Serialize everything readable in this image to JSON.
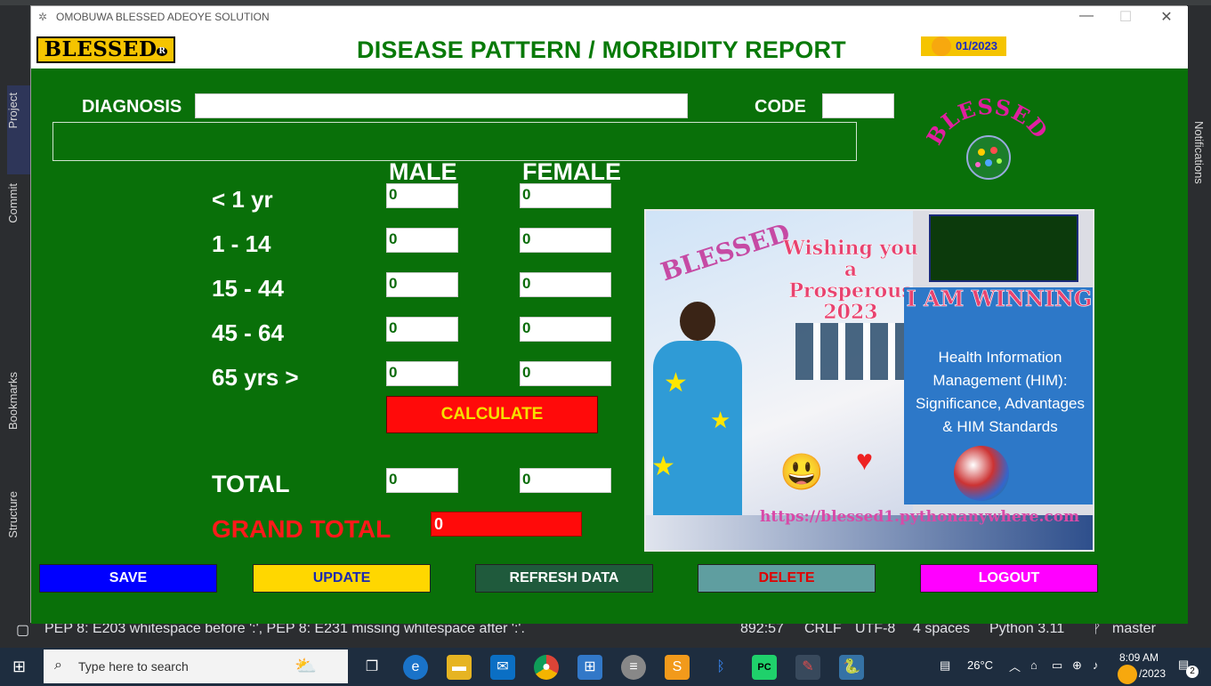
{
  "ide": {
    "left_tabs": [
      "Project",
      "Commit",
      "Bookmarks",
      "Structure"
    ],
    "right_tabs": [
      "Notifications"
    ],
    "status": {
      "message": "PEP 8: E203 whitespace before ':', PEP 8: E231 missing whitespace after ':'.",
      "position": "892:57",
      "line_sep": "CRLF",
      "encoding": "UTF-8",
      "indent": "4 spaces",
      "interpreter": "Python 3.11",
      "branch": "master"
    }
  },
  "window": {
    "title": "OMOBUWA BLESSED ADEOYE SOLUTION",
    "controls": {
      "minimize": "—",
      "maximize": "☐",
      "close": "✕"
    }
  },
  "header": {
    "logo": "BLESSED",
    "logo_mark": "R",
    "title": "DISEASE PATTERN / MORBIDITY REPORT",
    "date": "01/2023"
  },
  "form": {
    "diagnosis_label": "DIAGNOSIS",
    "diagnosis_value": "",
    "code_label": "CODE",
    "code_value": "",
    "description_value": "",
    "male_header": "MALE",
    "female_header": "FEMALE",
    "age_groups": [
      {
        "label": "< 1 yr",
        "male": "0",
        "female": "0"
      },
      {
        "label": "1 - 14",
        "male": "0",
        "female": "0"
      },
      {
        "label": "15 - 44",
        "male": "0",
        "female": "0"
      },
      {
        "label": "45 - 64",
        "male": "0",
        "female": "0"
      },
      {
        "label": "65 yrs >",
        "male": "0",
        "female": "0"
      }
    ],
    "calculate_label": "CALCULATE",
    "total_label": "TOTAL",
    "total_male": "0",
    "total_female": "0",
    "grand_total_label": "GRAND TOTAL",
    "grand_total_value": "0"
  },
  "side_logo": "BLESSED",
  "promo": {
    "greeting": "Wishing you a Prosperous 2023",
    "headline": "I AM WINNING",
    "topic": "Health Information Management (HIM): Significance, Advantages & HIM Standards",
    "url": "https://blessed1.pythonanywhere.com",
    "watermark": "BLESSED"
  },
  "actions": {
    "save": "SAVE",
    "update": "UPDATE",
    "refresh": "REFRESH DATA",
    "delete": "DELETE",
    "logout": "LOGOUT"
  },
  "colors": {
    "form_bg": "#097009",
    "title_green": "#087a08",
    "save": "#0000ff",
    "update": "#ffd700",
    "refresh": "#1f5a3c",
    "delete": "#5f9ea0",
    "logout": "#ff00ff"
  },
  "taskbar": {
    "search_placeholder": "Type here to search",
    "weather": "26°C",
    "time": "8:09 AM",
    "date": "/2023",
    "notification_count": "2"
  }
}
